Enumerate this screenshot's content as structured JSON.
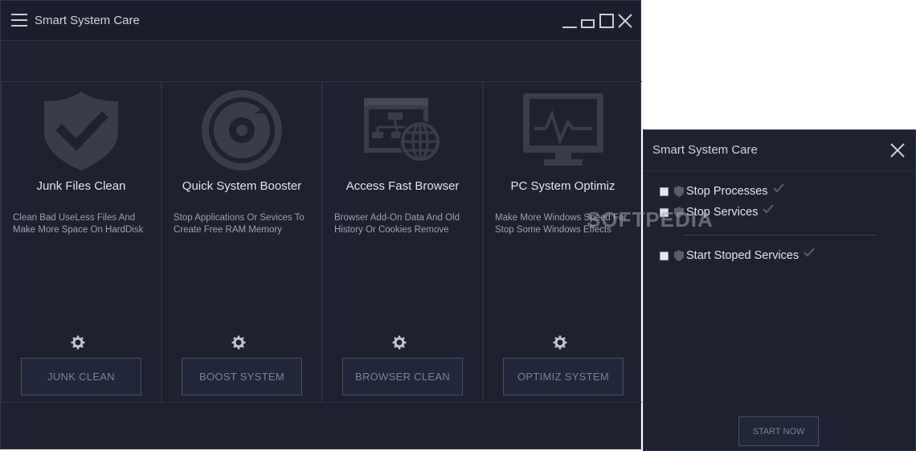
{
  "window": {
    "title": "Smart System Care",
    "controls": [
      "minimize-icon",
      "restore-icon",
      "maximize-icon",
      "close-icon"
    ]
  },
  "cards": [
    {
      "icon": "shield-check-icon",
      "name": "Junk Files Clean",
      "desc_line1": "Clean Bad UseLess Files And",
      "desc_line2": "Make More Space On HardDisk",
      "button": "JUNK CLEAN"
    },
    {
      "icon": "speedometer-icon",
      "name": "Quick System Booster",
      "desc_line1": "Stop Applications Or Sevices To",
      "desc_line2": "Create Free RAM Memory",
      "button": "BOOST SYSTEM"
    },
    {
      "icon": "browser-network-icon",
      "name": "Access Fast Browser",
      "desc_line1": "Browser Add-On Data And Old",
      "desc_line2": "History Or Cookies Remove",
      "button": "BROWSER CLEAN"
    },
    {
      "icon": "monitor-pulse-icon",
      "name": "PC System Optimiz",
      "desc_line1": "Make More Windows Speed For",
      "desc_line2": "Stop Some Windows Effects",
      "button": "OPTIMIZ SYSTEM"
    }
  ],
  "panel": {
    "title": "Smart System Care",
    "options": [
      {
        "label": "Stop Processes"
      },
      {
        "label": "Stop Services"
      },
      {
        "label": "Start Stoped Services"
      }
    ],
    "start_button": "START NOW"
  },
  "watermark": "SOFTPEDIA",
  "colors": {
    "background": "#1d2130",
    "titlebar": "#1b1f2d",
    "icon": "#3a3d48",
    "button_border": "#4a4f60",
    "text": "#e3e5ea",
    "muted_text": "#9ea2ae"
  }
}
